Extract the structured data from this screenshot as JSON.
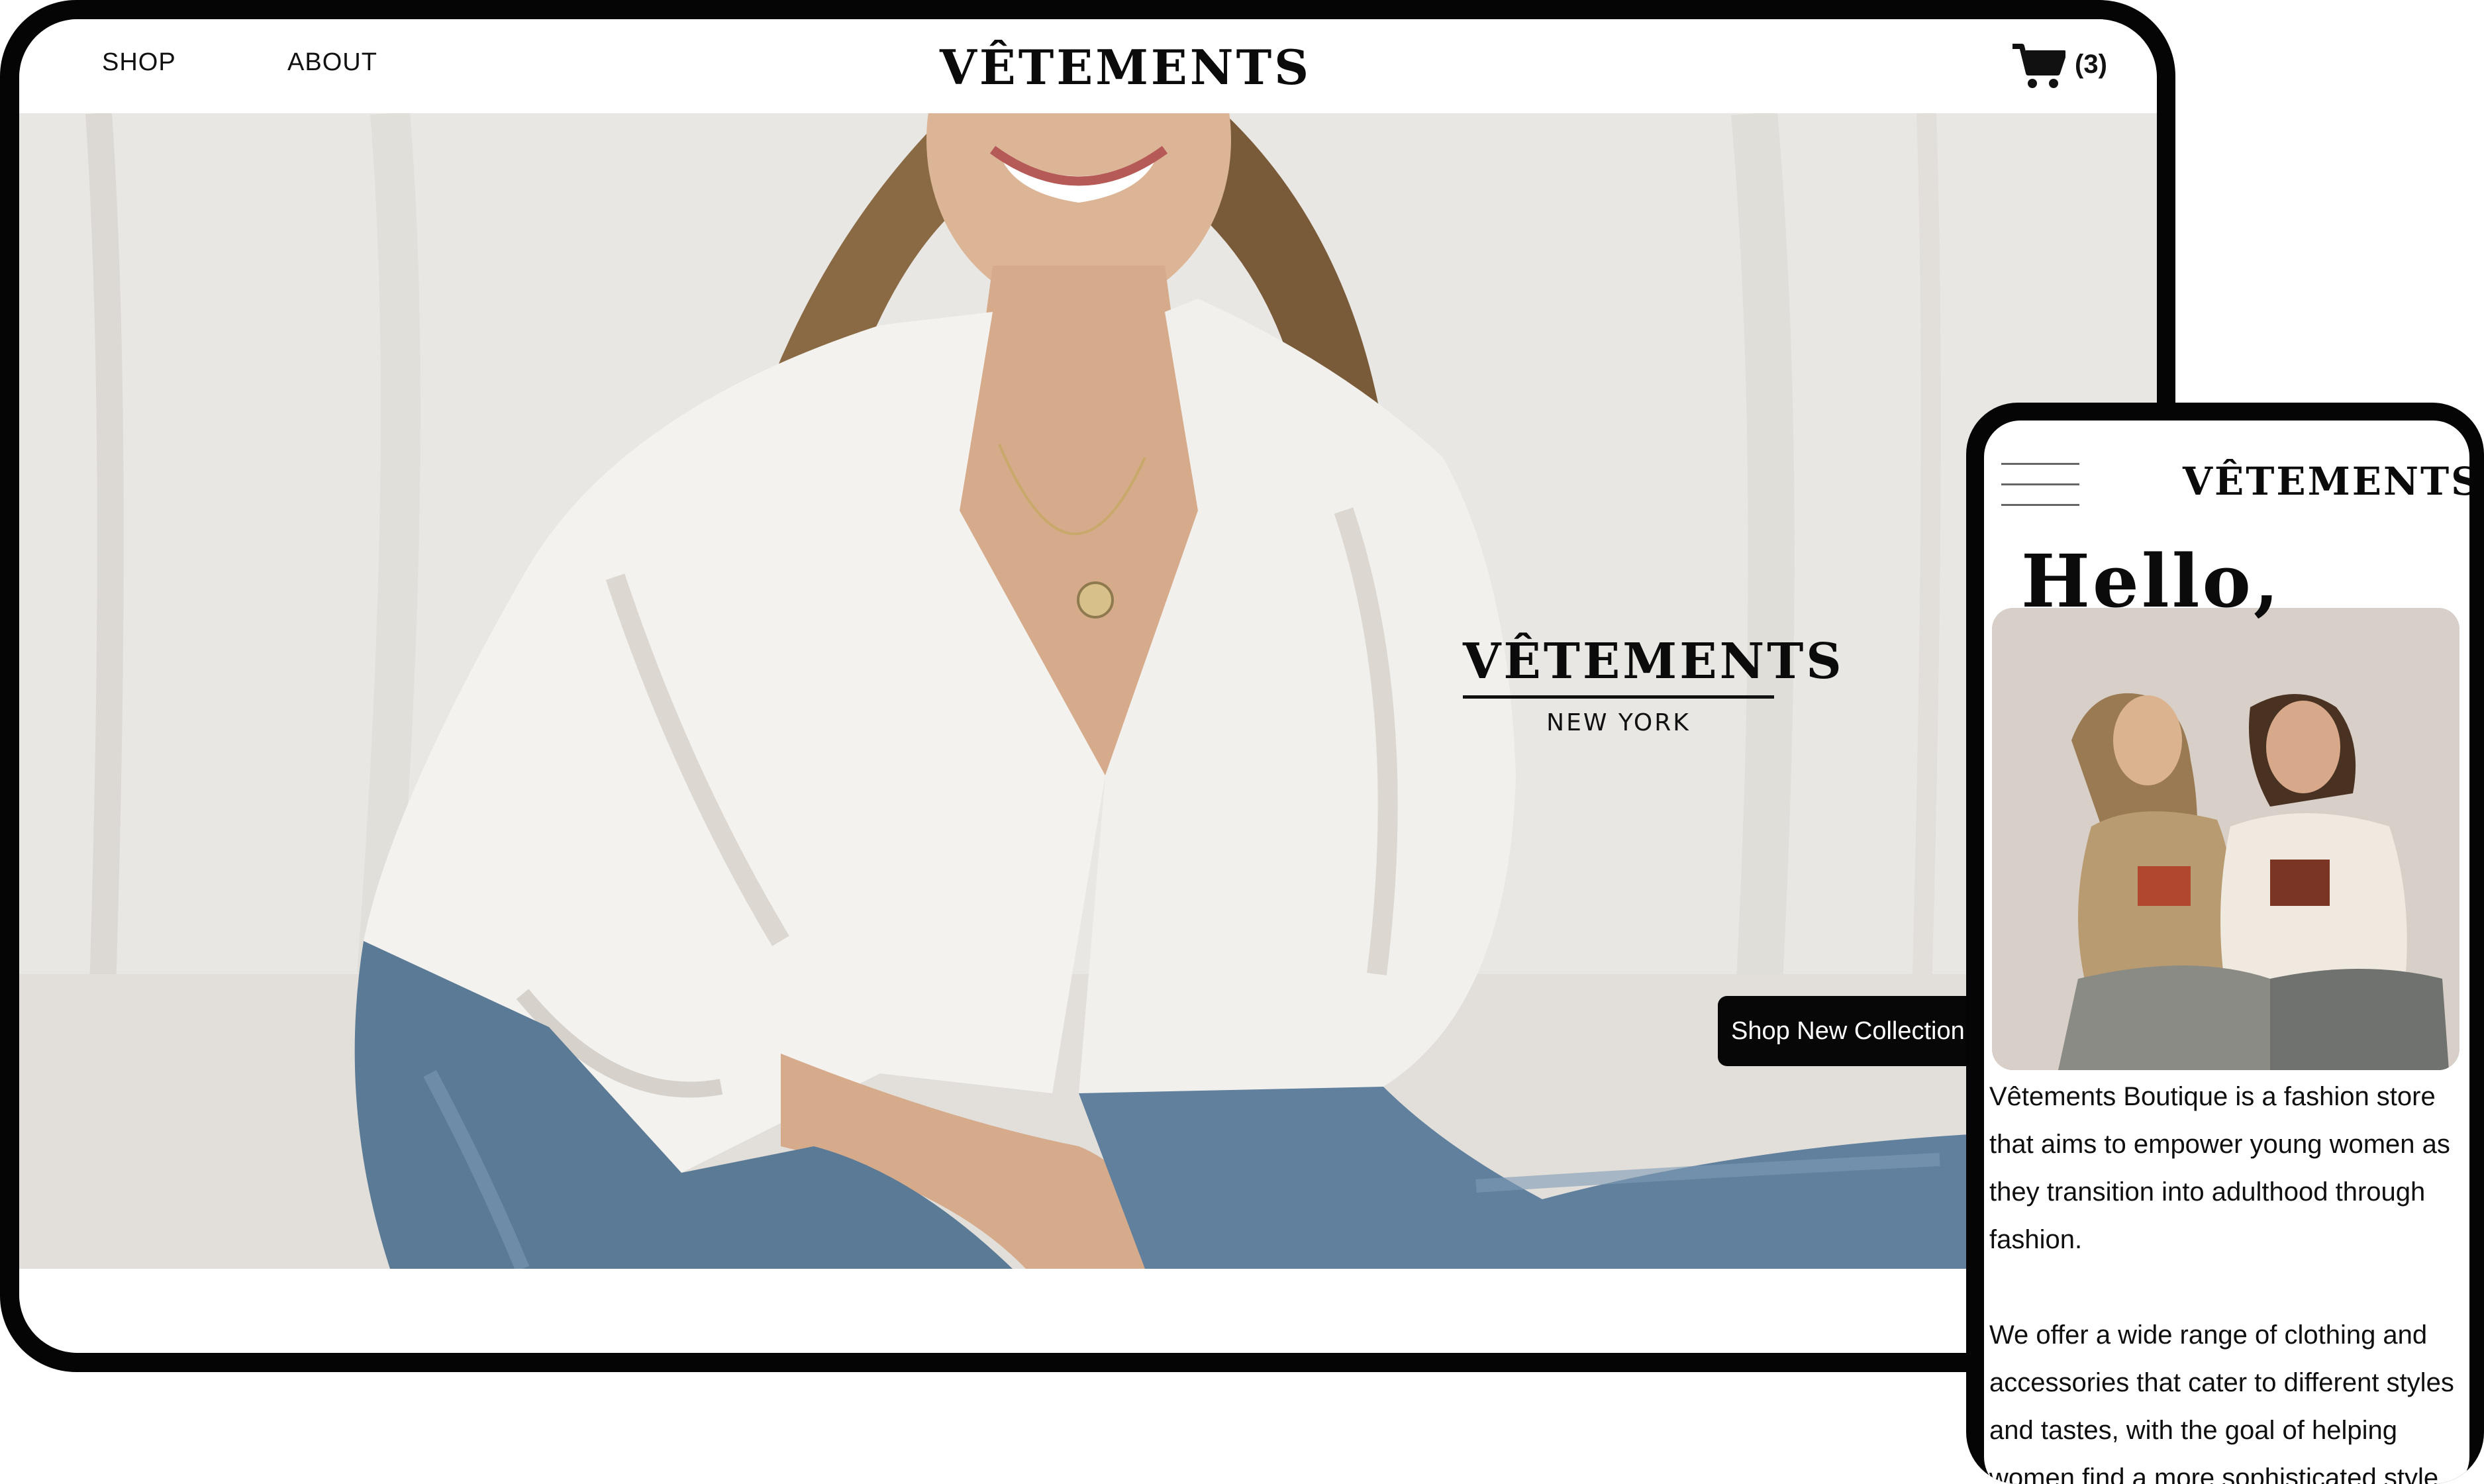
{
  "desktop": {
    "nav": {
      "shop_label": "SHOP",
      "about_label": "ABOUT",
      "logo": "VÊTEMENTS",
      "cart_icon": "shopping-cart-icon",
      "cart_count": "(3)"
    },
    "hero": {
      "logo": "VÊTEMENTS",
      "tagline": "NEW YORK",
      "cta_label": "Shop New Collection"
    }
  },
  "mobile": {
    "menu_icon": "hamburger-menu-icon",
    "logo": "VÊTEMENTS",
    "greeting": "Hello,",
    "paragraphs": [
      "Vêtements Boutique is a fashion store that aims to empower young women as they transition into adulthood through fashion.",
      "We offer a wide range of clothing and accessories that cater to different styles and tastes, with the goal of helping women find a more sophisticated style"
    ]
  },
  "colors": {
    "frame": "#050505",
    "background": "#ffffff",
    "text": "#111111",
    "button_bg": "#070707",
    "button_text": "#ffffff"
  }
}
